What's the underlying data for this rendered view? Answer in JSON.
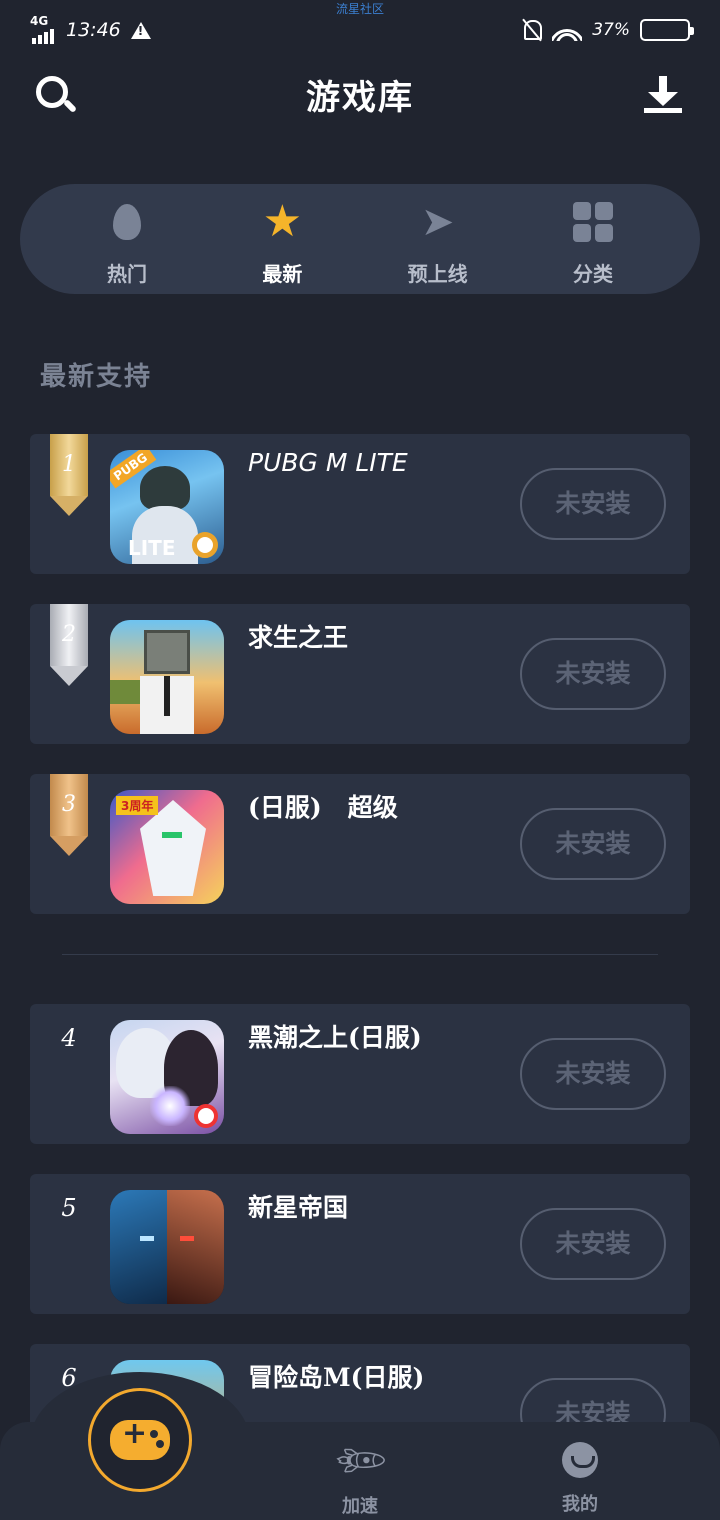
{
  "status_bar": {
    "network": "4G",
    "time": "13:46",
    "center_text": "流星社区",
    "battery_percent": "37%",
    "battery_level": 0.37
  },
  "header": {
    "title": "游戏库"
  },
  "tabs": [
    {
      "label": "热门",
      "icon": "flame-icon"
    },
    {
      "label": "最新",
      "icon": "star-icon",
      "active": true
    },
    {
      "label": "预上线",
      "icon": "paper-plane-icon"
    },
    {
      "label": "分类",
      "icon": "grid-icon"
    }
  ],
  "section_title": "最新支持",
  "games": [
    {
      "rank": "1",
      "name": "PUBG M LITE",
      "button": "未安装"
    },
    {
      "rank": "2",
      "name": "求生之王",
      "button": "未安装"
    },
    {
      "rank": "3",
      "name": "(日服)   超级",
      "button": "未安装"
    },
    {
      "rank": "4",
      "name": "黑潮之上(日服)",
      "button": "未安装"
    },
    {
      "rank": "5",
      "name": "新星帝国",
      "button": "未安装"
    },
    {
      "rank": "6",
      "name": "冒险岛M(日服)",
      "button": "未安装"
    }
  ],
  "thumb_text": {
    "pubg_tag": "PUBG",
    "pubg_lite": "LITE",
    "mecha_badge": "3周年"
  },
  "bottom_nav": [
    {
      "label": "",
      "icon": "gamepad-icon"
    },
    {
      "label": "加速",
      "icon": "rocket-icon"
    },
    {
      "label": "我的",
      "icon": "smile-icon"
    }
  ],
  "colors": {
    "background": "#20242f",
    "accent": "#f5ad2f",
    "card": "#2b3242"
  }
}
